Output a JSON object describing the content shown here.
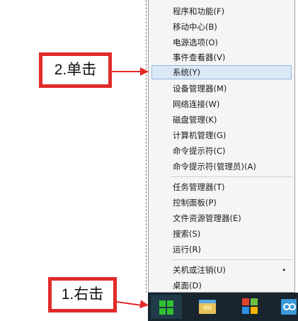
{
  "menu": {
    "group1": [
      {
        "label": "程序和功能(F)"
      },
      {
        "label": "移动中心(B)"
      },
      {
        "label": "电源选项(O)"
      },
      {
        "label": "事件查看器(V)"
      },
      {
        "label": "系统(Y)"
      },
      {
        "label": "设备管理器(M)"
      },
      {
        "label": "网络连接(W)"
      },
      {
        "label": "磁盘管理(K)"
      },
      {
        "label": "计算机管理(G)"
      },
      {
        "label": "命令提示符(C)"
      },
      {
        "label": "命令提示符(管理员)(A)"
      }
    ],
    "group2": [
      {
        "label": "任务管理器(T)"
      },
      {
        "label": "控制面板(P)"
      },
      {
        "label": "文件资源管理器(E)"
      },
      {
        "label": "搜索(S)"
      },
      {
        "label": "运行(R)"
      }
    ],
    "group3": [
      {
        "label": "关机或注销(U)",
        "submenu_arrow": "▸"
      },
      {
        "label": "桌面(D)"
      }
    ],
    "highlighted_item": "系统(Y)"
  },
  "callouts": {
    "step2": "2.单击",
    "step1": "1.右击"
  },
  "taskbar": {
    "icons": [
      "windows-logo-icon",
      "file-explorer-icon",
      "store-icon",
      "network-app-icon"
    ]
  },
  "colors": {
    "callout_red": "#e12a2a",
    "highlight_bg": "#dbe8f6",
    "taskbar_bg": "#18242e",
    "windows_green": "#2fc12f"
  }
}
